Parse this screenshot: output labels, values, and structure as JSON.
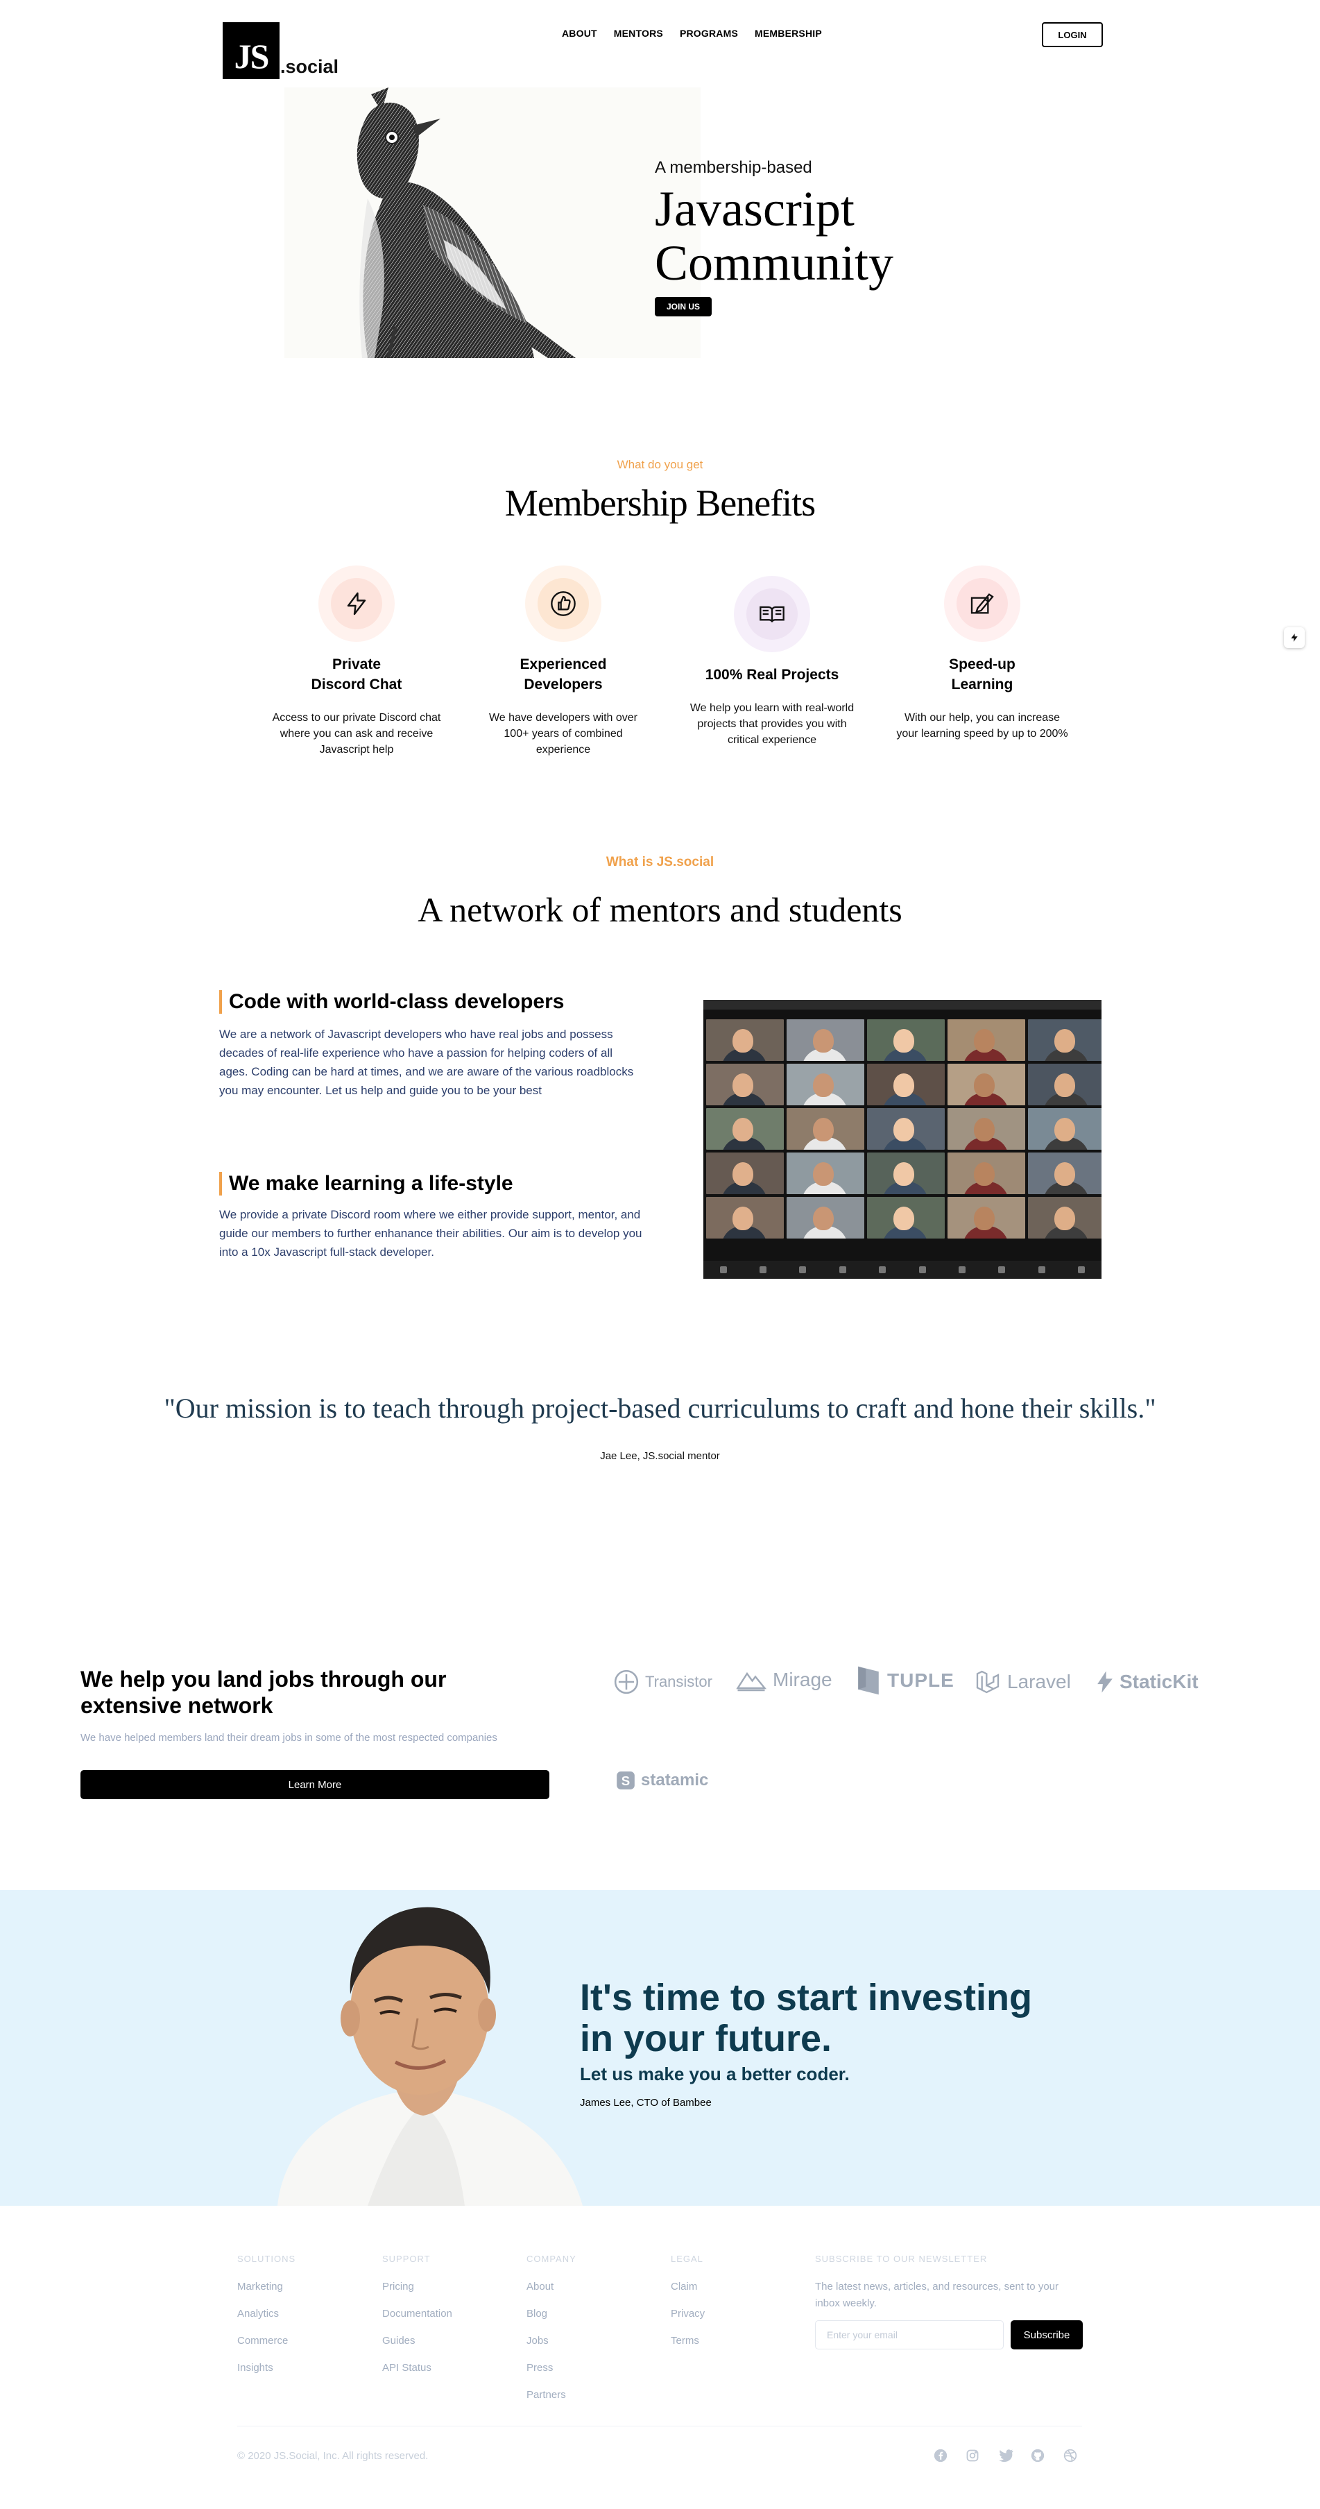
{
  "header": {
    "logo_box": "JS",
    "logo_suffix": ".social",
    "nav": [
      "ABOUT",
      "MENTORS",
      "PROGRAMS",
      "MEMBERSHIP"
    ],
    "login": "LOGIN"
  },
  "hero": {
    "subtitle": "A membership-based",
    "title_line1": "Javascript",
    "title_line2": "Community",
    "cta": "JOIN US"
  },
  "benefits": {
    "eyebrow": "What do you get",
    "title": "Membership Benefits",
    "items": [
      {
        "title": "Private\nDiscord Chat",
        "desc": "Access to our private Discord chat where you can ask and receive Javascript help",
        "icon": "lightning-icon",
        "color": "#fde3dc"
      },
      {
        "title": "Experienced\nDevelopers",
        "desc": "We have developers with over 100+ years of combined experience",
        "icon": "thumbs-up-icon",
        "color": "#fde6d2"
      },
      {
        "title": "100% Real Projects",
        "desc": "We help you learn with real-world projects that provides you with critical experience",
        "icon": "book-icon",
        "color": "#eee3f3"
      },
      {
        "title": "Speed-up\nLearning",
        "desc": "With our help, you can increase your learning speed by up to 200%",
        "icon": "rocket-icon",
        "color": "#fde1e1"
      }
    ]
  },
  "network": {
    "eyebrow": "What is JS.social",
    "title": "A network of mentors and students",
    "features": [
      {
        "heading": "Code with world-class developers",
        "text": "We are a network of Javascript developers who have real jobs and possess decades of real-life experience who have a passion for helping coders of all ages. Coding can be hard at times, and we are aware of the various roadblocks you may encounter. Let us help and guide you to be your best"
      },
      {
        "heading": "We make learning a life-style",
        "text": "We provide a private Discord room where we either provide support, mentor, and guide our members to further enhanance their abilities. Our aim is to develop you into a 10x Javascript full-stack developer."
      }
    ]
  },
  "quote": {
    "text": "\"Our mission is to teach through project-based curriculums to craft and hone their skills.\"",
    "author": "Jae Lee, JS.social mentor"
  },
  "jobs": {
    "title": "We help you land jobs through our extensive network",
    "subtitle": "We have helped members land their dream jobs in some of the most respected companies",
    "button": "Learn More",
    "companies": [
      "Transistor",
      "Mirage",
      "TUPLE",
      "Laravel",
      "StaticKit",
      "statamic"
    ]
  },
  "cta": {
    "title": "It's time to start investing in your future.",
    "subtitle": "Let us make you a better coder.",
    "author": "James Lee, CTO of Bambee"
  },
  "footer": {
    "columns": [
      {
        "heading": "SOLUTIONS",
        "links": [
          "Marketing",
          "Analytics",
          "Commerce",
          "Insights"
        ]
      },
      {
        "heading": "SUPPORT",
        "links": [
          "Pricing",
          "Documentation",
          "Guides",
          "API Status"
        ]
      },
      {
        "heading": "COMPANY",
        "links": [
          "About",
          "Blog",
          "Jobs",
          "Press",
          "Partners"
        ]
      },
      {
        "heading": "LEGAL",
        "links": [
          "Claim",
          "Privacy",
          "Terms"
        ]
      }
    ],
    "newsletter": {
      "heading": "SUBSCRIBE TO OUR NEWSLETTER",
      "text": "The latest news, articles, and resources, sent to your inbox weekly.",
      "placeholder": "Enter your email",
      "button": "Subscribe"
    },
    "copyright": "© 2020 JS.Social, Inc. All rights reserved.",
    "social_icons": [
      "facebook-icon",
      "instagram-icon",
      "twitter-icon",
      "github-icon",
      "dribbble-icon"
    ]
  },
  "colors": {
    "accent": "#f0a14b",
    "cta_bg": "#e3f3fc",
    "cta_text": "#0e3b4f",
    "body_text": "#2c3e6b"
  }
}
